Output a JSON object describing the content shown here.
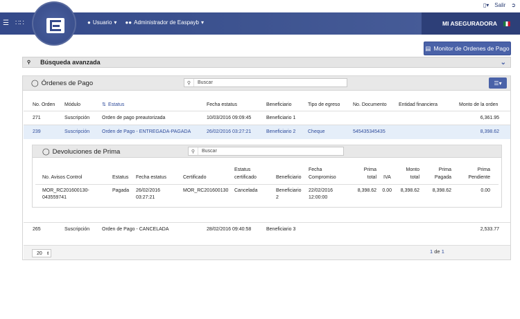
{
  "topbar": {
    "exit_label": "Salir"
  },
  "nav": {
    "user_menu": "Usuario",
    "admin_menu": "Administrador de Easpayb",
    "brand": "MI ASEGURADORA"
  },
  "monitor_button": "Monitor de Ordenes de Pago",
  "advanced_search": {
    "label": "Búsqueda avanzada"
  },
  "orders": {
    "title": "Órdenes de Pago",
    "search_placeholder": "Buscar",
    "columns": [
      "No. Orden",
      "Módulo",
      "Estatus",
      "Fecha estatus",
      "Beneficiario",
      "Tipo de egreso",
      "No. Documento",
      "Entidad financiera",
      "Monto de la orden"
    ],
    "rows": [
      {
        "no": "271",
        "modulo": "Suscripción",
        "estatus": "Orden de pago preautorizada",
        "fecha": "10/03/2016 09:09:45",
        "beneficiario": "Beneficiario 1",
        "tipo": "",
        "doc": "",
        "entidad": "",
        "monto": "6,361.95"
      },
      {
        "no": "239",
        "modulo": "Suscripción",
        "estatus": "Orden de Pago - ENTREGADA-PAGADA",
        "fecha": "26/02/2016 03:27:21",
        "beneficiario": "Beneficiario 2",
        "tipo": "Cheque",
        "doc": "545435345435",
        "entidad": "",
        "monto": "8,398.62"
      },
      {
        "no": "265",
        "modulo": "Suscripción",
        "estatus": "Orden de Pago - CANCELADA",
        "fecha": "28/02/2016 09:40:58",
        "beneficiario": "Beneficiario 3",
        "tipo": "",
        "doc": "",
        "entidad": "",
        "monto": "2,533.77"
      }
    ]
  },
  "devoluciones": {
    "title": "Devoluciones de Prima",
    "search_placeholder": "Buscar",
    "columns": {
      "avisos": "No. Avisos Control",
      "estatus": "Estatus",
      "fecha_estatus": "Fecha estatus",
      "certificado": "Certificado",
      "estatus_cert_1": "Estatus",
      "estatus_cert_2": "certificado",
      "beneficiario": "Beneficiario",
      "fecha_comp_1": "Fecha",
      "fecha_comp_2": "Compromiso",
      "prima_total_1": "Prima",
      "prima_total_2": "total",
      "iva": "IVA",
      "monto_total_1": "Monto",
      "monto_total_2": "total",
      "prima_pagada_1": "Prima",
      "prima_pagada_2": "Pagada",
      "prima_pend_1": "Prima",
      "prima_pend_2": "Pendiente"
    },
    "row": {
      "avisos_1": "MOR_RC201600130-",
      "avisos_2": "043559741",
      "estatus": "Pagada",
      "fecha_1": "26/02/2016",
      "fecha_2": "03:27:21",
      "certificado": "MOR_RC201600130",
      "estatus_cert": "Cancelada",
      "beneficiario_1": "Beneficiario",
      "beneficiario_2": "2",
      "fecha_comp_1": "22/02/2016",
      "fecha_comp_2": "12:00:00",
      "prima_total": "8,398.62",
      "iva": "0.00",
      "monto_total": "8,398.62",
      "prima_pagada": "8,398.62",
      "prima_pendiente": "0.00"
    }
  },
  "pager": {
    "page_size": "20",
    "current": "1",
    "of": "de",
    "total": "1"
  }
}
